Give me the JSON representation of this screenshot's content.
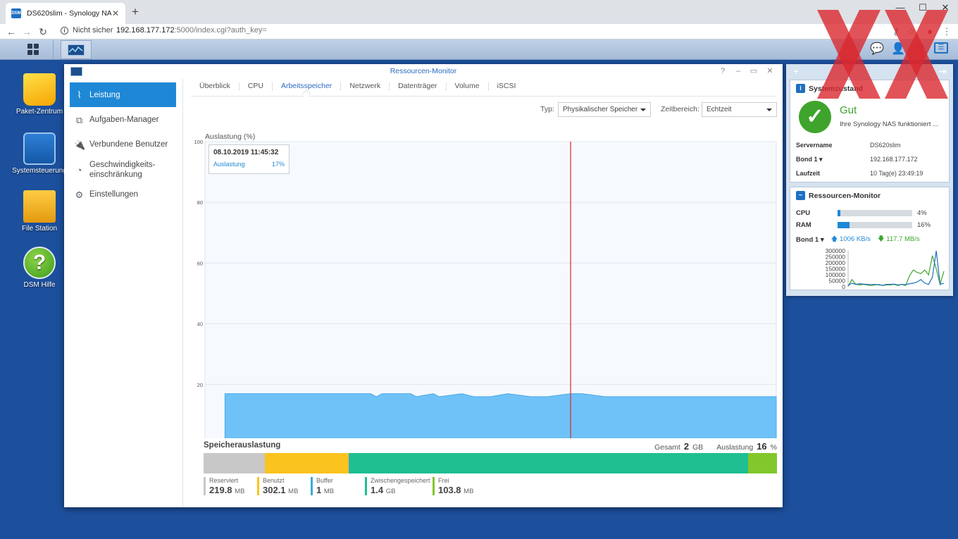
{
  "browser": {
    "tab_title": "DS620slim - Synology NAS",
    "favicon_text": "DSM",
    "security_label": "Nicht sicher",
    "url_host": "192.168.177.172",
    "url_path": ":5000/index.cgi?auth_key="
  },
  "desktop": {
    "icons": [
      {
        "label": "Paket-Zentrum"
      },
      {
        "label": "Systemsteuerung"
      },
      {
        "label": "File Station"
      },
      {
        "label": "DSM Hilfe"
      }
    ]
  },
  "window": {
    "title": "Ressourcen-Monitor",
    "sidebar": [
      {
        "label": "Leistung",
        "icon": "performance-icon",
        "active": true
      },
      {
        "label": "Aufgaben-Manager",
        "icon": "task-manager-icon"
      },
      {
        "label": "Verbundene Benutzer",
        "icon": "connected-users-icon"
      },
      {
        "label": "Geschwindigkeits-\neinschränkung",
        "icon": "speed-limit-icon"
      },
      {
        "label": "Einstellungen",
        "icon": "settings-icon"
      }
    ],
    "tabs": [
      "Überblick",
      "CPU",
      "Arbeitsspeicher",
      "Netzwerk",
      "Datenträger",
      "Volume",
      "iSCSI"
    ],
    "active_tab": "Arbeitsspeicher",
    "type_label": "Typ:",
    "type_value": "Physikalischer Speicher",
    "range_label": "Zeitbereich:",
    "range_value": "Echtzeit",
    "tooltip": {
      "time": "08.10.2019 11:45:32",
      "series": "Auslastung",
      "value": "17%"
    },
    "memory": {
      "title": "Speicherauslastung",
      "total_label": "Gesamt",
      "total_value": "2",
      "total_unit": "GB",
      "usage_label": "Auslastung",
      "usage_value": "16",
      "usage_unit": "%",
      "segments": [
        {
          "name": "Reserviert",
          "value": "219.8",
          "unit": "MB",
          "color": "#c8c8c8",
          "mb": 219.8
        },
        {
          "name": "Benutzt",
          "value": "302.1",
          "unit": "MB",
          "color": "#fbc31d",
          "mb": 302.1
        },
        {
          "name": "Buffer",
          "value": "1",
          "unit": "MB",
          "color": "#3ba9d9",
          "mb": 1
        },
        {
          "name": "Zwischengespeichert",
          "value": "1.4",
          "unit": "GB",
          "color": "#1fbf92",
          "mb": 1433.6
        },
        {
          "name": "Frei",
          "value": "103.8",
          "unit": "MB",
          "color": "#82c72c",
          "mb": 103.8
        }
      ]
    }
  },
  "chart_data": {
    "type": "area",
    "ylabel": "Auslastung (%)",
    "ylim": [
      0,
      100
    ],
    "yticks": [
      0,
      20,
      40,
      60,
      80,
      100
    ],
    "grid": true,
    "series": [
      {
        "name": "Auslastung",
        "color": "#6ec2f7",
        "x": [
          0.035,
          0.09,
          0.14,
          0.2,
          0.26,
          0.29,
          0.3,
          0.31,
          0.32,
          0.33,
          0.34,
          0.36,
          0.37,
          0.4,
          0.41,
          0.45,
          0.47,
          0.5,
          0.53,
          0.57,
          0.6,
          0.64,
          0.66,
          0.7,
          0.8,
          0.9,
          1.0
        ],
        "values": [
          17,
          17,
          17,
          17,
          17,
          17,
          16,
          17,
          17,
          17,
          17,
          17,
          16,
          17,
          16,
          17,
          16,
          16,
          17,
          16,
          16,
          17,
          17,
          16,
          16,
          16,
          16
        ]
      }
    ],
    "cursor_x": 0.64
  },
  "widgets": {
    "system_health": {
      "title": "Systemzustand",
      "status": "Gut",
      "description": "Ihre Synology NAS funktioniert ...",
      "rows": [
        {
          "key": "Servername",
          "value": "DS620slim"
        },
        {
          "key": "Bond 1 ▾",
          "value": "192.168.177.172"
        },
        {
          "key": "Laufzeit",
          "value": "10 Tag(e) 23:49:19"
        }
      ]
    },
    "resource_monitor": {
      "title": "Ressourcen-Monitor",
      "cpu_label": "CPU",
      "cpu_percent": 4,
      "cpu_text": "4%",
      "ram_label": "RAM",
      "ram_percent": 16,
      "ram_text": "16%",
      "bond_label": "Bond 1 ▾",
      "upload": "1006 KB/s",
      "download": "117.7 MB/s",
      "net_yticks": [
        "300000",
        "250000",
        "200000",
        "150000",
        "100000",
        "50000",
        "0"
      ],
      "net_up": [
        10000,
        30000,
        20000,
        25000,
        22000,
        20000,
        18000,
        20000,
        15000,
        12000,
        20000,
        20000,
        22000,
        15000,
        20000,
        18000,
        25000,
        30000,
        40000,
        60000,
        30000,
        20000,
        80000,
        310000,
        20000,
        30000
      ],
      "net_down": [
        5000,
        60000,
        20000,
        15000,
        20000,
        15000,
        10000,
        15000,
        20000,
        10000,
        15000,
        15000,
        20000,
        10000,
        20000,
        10000,
        90000,
        140000,
        120000,
        110000,
        140000,
        100000,
        260000,
        150000,
        20000,
        130000
      ]
    }
  }
}
